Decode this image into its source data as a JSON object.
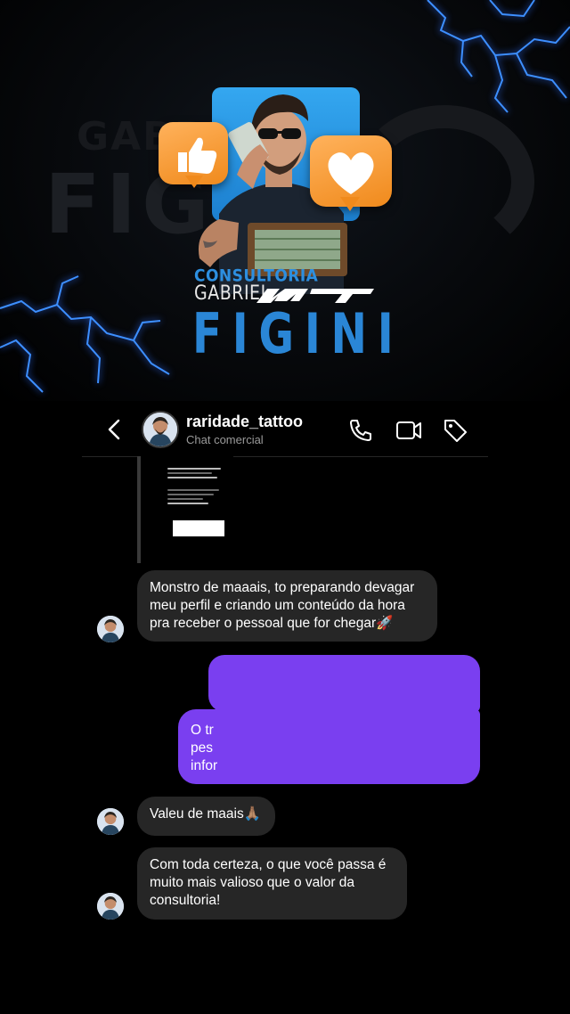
{
  "banner": {
    "bg_gabriel": "GABRIEL",
    "bg_figini": "FIGI",
    "consultoria": "CONSULTORIA",
    "gabriel": "GABRIEL",
    "figini": "FIGINI"
  },
  "header": {
    "username": "raridade_tattoo",
    "subtitle": "Chat comercial"
  },
  "messages": [
    {
      "from": "them",
      "text": "Monstro de maaais, to preparando devagar meu perfil e criando um conteúdo da hora pra receber o pessoal que for chegar🚀"
    },
    {
      "from": "me",
      "lines": [
        "O tr",
        "pes",
        "infor"
      ]
    },
    {
      "from": "them",
      "text": "Valeu de maais🙏🏽"
    },
    {
      "from": "them",
      "text": "Com toda certeza, o que você passa é muito mais valioso que o valor da consultoria!"
    }
  ],
  "colors": {
    "outgoing_bubble": "#7a3ff0",
    "incoming_bubble": "#262626",
    "accent_blue": "#2a86d6"
  }
}
